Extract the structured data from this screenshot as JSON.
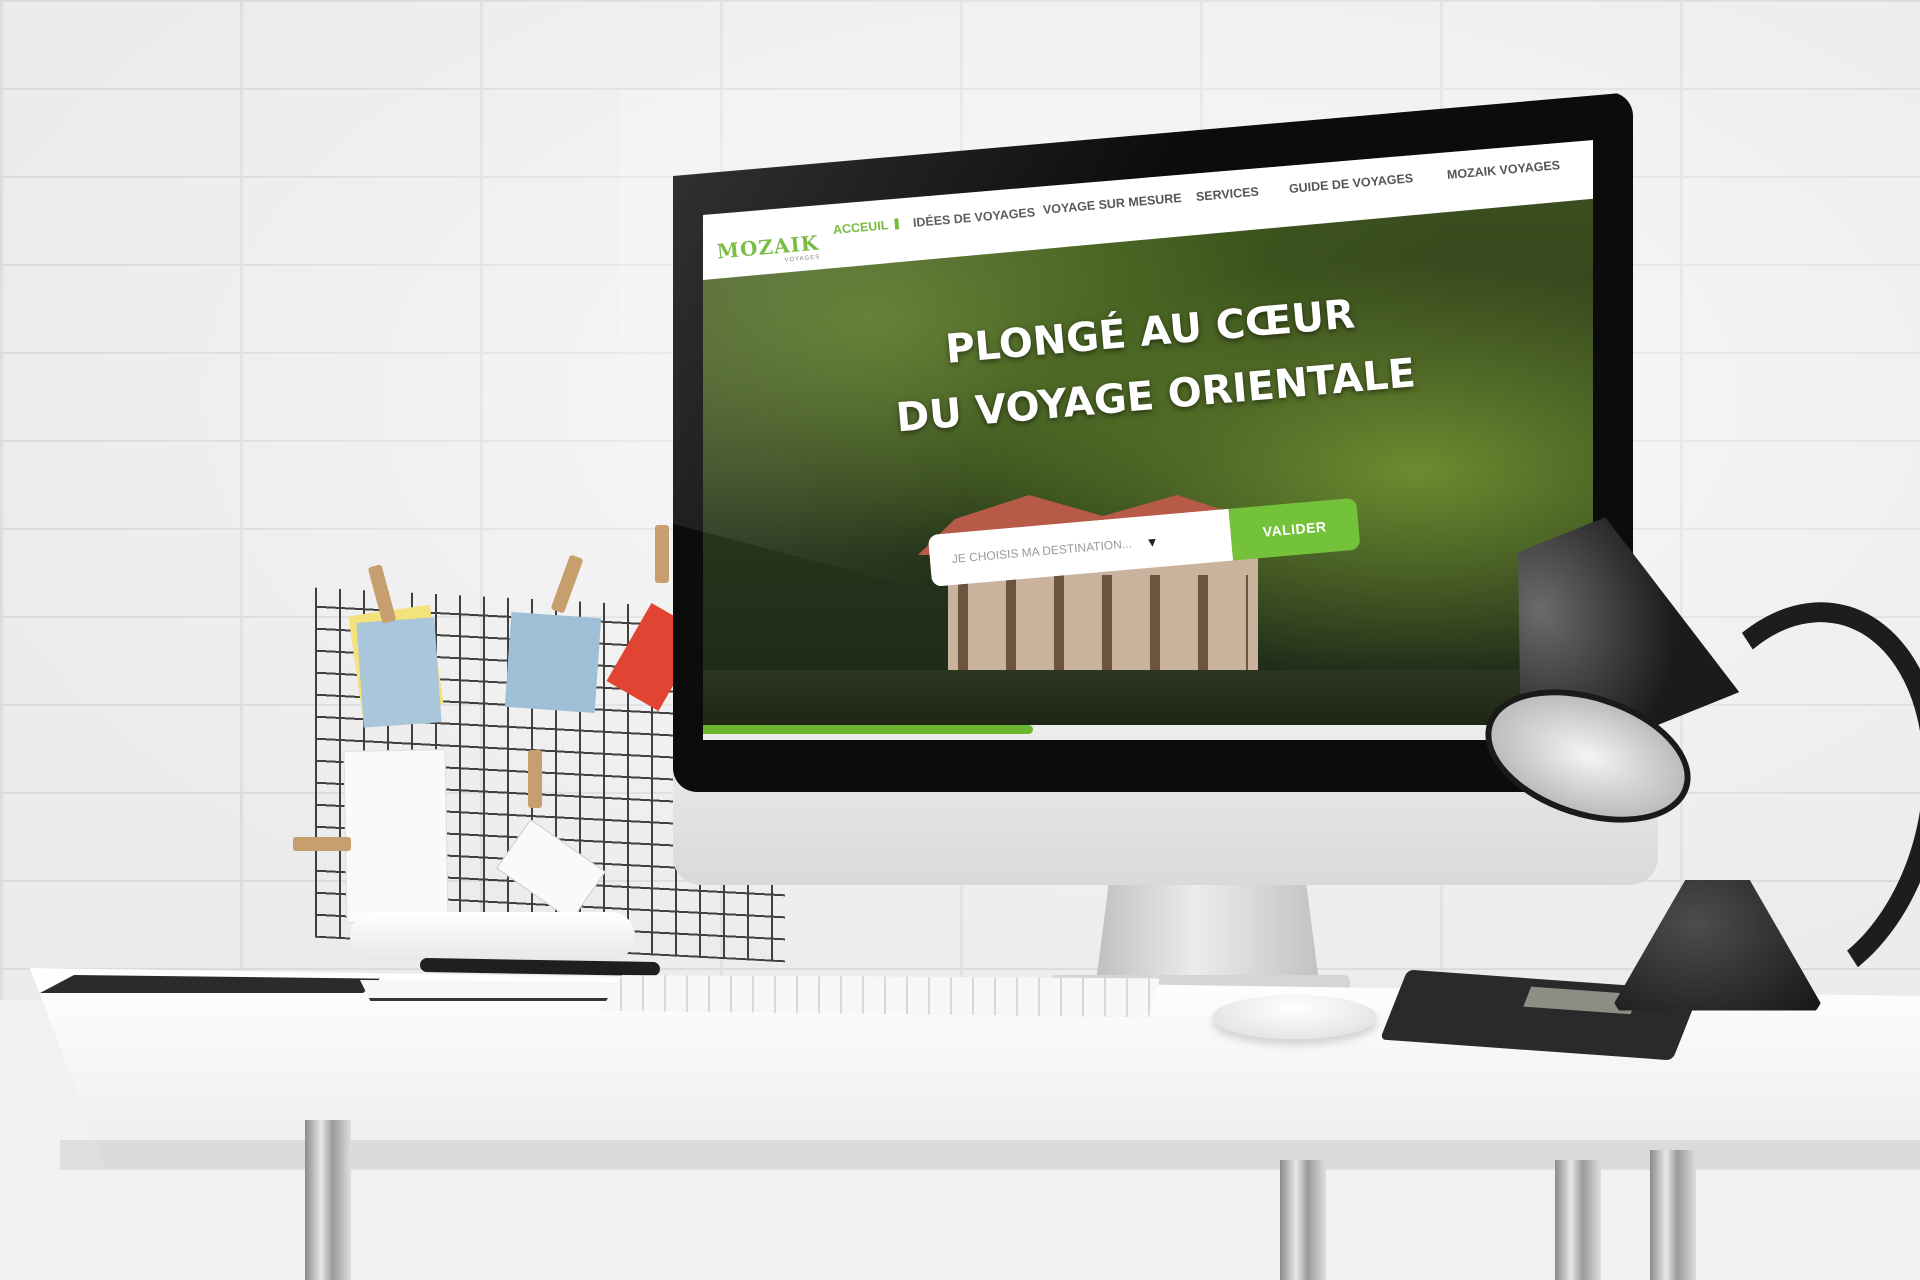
{
  "website": {
    "logo": {
      "name": "MOZAIK",
      "tagline": "VOYAGES"
    },
    "nav": {
      "items": [
        {
          "label": "ACCEUIL",
          "active": true
        },
        {
          "label": "IDÉES DE VOYAGES",
          "active": false
        },
        {
          "label": "VOYAGE SUR MESURE",
          "active": false
        },
        {
          "label": "SERVICES",
          "active": false
        },
        {
          "label": "GUIDE DE VOYAGES",
          "active": false
        },
        {
          "label": "MOZAIK VOYAGES",
          "active": false
        }
      ]
    },
    "hero": {
      "title_line_1": "PLONGÉ AU CŒUR",
      "title_line_2": "DU VOYAGE ORIENTALE"
    },
    "search": {
      "select_value": "JE CHOISIS MA DESTINATION...",
      "caret_icon": "▼",
      "submit_label": "VALIDER"
    }
  },
  "colors": {
    "accent_green": "#74c23a",
    "nav_text": "#555555",
    "hero_text": "#ffffff"
  },
  "scene": {
    "objects": [
      "brick-wall",
      "memo-board",
      "desk",
      "monitor",
      "keyboard",
      "mouse",
      "calculator",
      "desk-lamp",
      "notebook",
      "pen"
    ]
  }
}
